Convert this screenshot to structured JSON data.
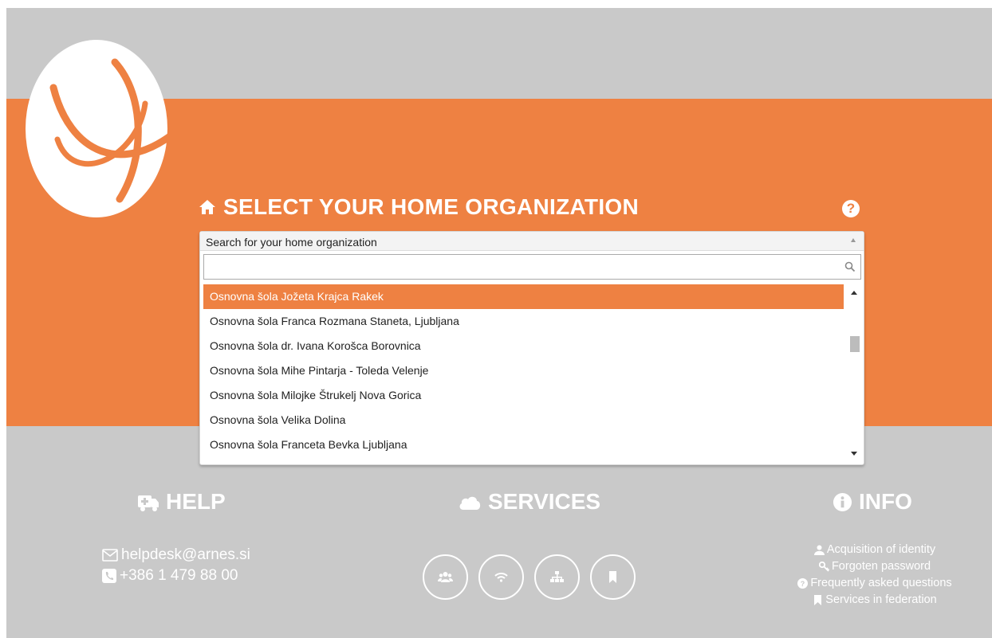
{
  "colors": {
    "accent": "#ee8142",
    "background": "#c9c9c9",
    "white": "#ffffff"
  },
  "header": {
    "title": "SELECT YOUR HOME ORGANIZATION",
    "home_icon": "home-icon",
    "help_icon": "question-circle-icon"
  },
  "selector": {
    "placeholder": "Search for your home organization",
    "search_value": "",
    "options": [
      "Osnovna šola Jožeta Krajca Rakek",
      "Osnovna šola Franca Rozmana Staneta, Ljubljana",
      "Osnovna šola dr. Ivana Korošca Borovnica",
      "Osnovna šola Mihe Pintarja - Toleda Velenje",
      "Osnovna šola Milojke Štrukelj Nova Gorica",
      "Osnovna šola Velika Dolina",
      "Osnovna šola Franceta Bevka Ljubljana"
    ],
    "highlighted_index": 0
  },
  "footer": {
    "help": {
      "title": "HELP",
      "email": "helpdesk@arnes.si",
      "phone": "+386 1 479 88 00"
    },
    "services": {
      "title": "SERVICES",
      "icons": [
        "users-icon",
        "wifi-icon",
        "sitemap-icon",
        "bookmark-icon"
      ]
    },
    "info": {
      "title": "INFO",
      "links": [
        {
          "icon": "user-icon",
          "label": "Acquisition of identity"
        },
        {
          "icon": "key-icon",
          "label": "Forgoten password"
        },
        {
          "icon": "question-circle-icon",
          "label": "Frequently asked questions"
        },
        {
          "icon": "bookmark-icon",
          "label": "Services in federation"
        }
      ]
    }
  }
}
